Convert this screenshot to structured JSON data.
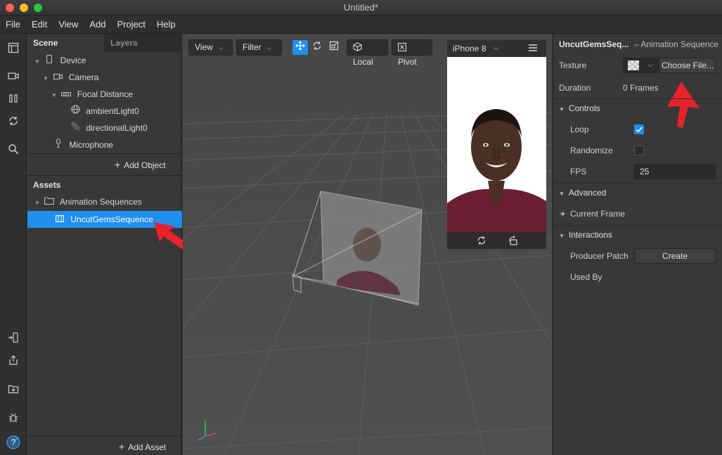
{
  "window": {
    "title": "Untitled*"
  },
  "menu": [
    "File",
    "Edit",
    "View",
    "Add",
    "Project",
    "Help"
  ],
  "scene_panel": {
    "tabs": [
      "Scene",
      "Layers"
    ],
    "items": [
      {
        "label": "Device",
        "icon": "phone-icon"
      },
      {
        "label": "Camera",
        "icon": "camera-icon"
      },
      {
        "label": "Focal Distance",
        "icon": "focal-distance-icon"
      },
      {
        "label": "ambientLight0",
        "icon": "globe-icon"
      },
      {
        "label": "directionalLight0",
        "icon": "directional-light-icon"
      },
      {
        "label": "Microphone",
        "icon": "microphone-icon"
      }
    ],
    "add_object": "Add Object"
  },
  "assets_panel": {
    "title": "Assets",
    "folder": "Animation Sequences",
    "selected_item": "UncutGemsSequence",
    "add_asset": "Add Asset"
  },
  "viewport": {
    "view_label": "View",
    "filter_label": "Filter",
    "local_label": "Local",
    "pivot_label": "Pivot",
    "device_label": "iPhone 8"
  },
  "inspector": {
    "name": "UncutGemsSeq...",
    "type": "– Animation Sequence",
    "texture_label": "Texture",
    "choose_file": "Choose File...",
    "duration_label": "Duration",
    "duration_value": "0 Frames",
    "controls_label": "Controls",
    "loop_label": "Loop",
    "randomize_label": "Randomize",
    "fps_label": "FPS",
    "fps_value": "25",
    "advanced_label": "Advanced",
    "current_frame_label": "Current Frame",
    "interactions_label": "Interactions",
    "producer_patch_label": "Producer Patch",
    "create_label": "Create",
    "used_by_label": "Used By"
  },
  "colors": {
    "accent": "#1f8ff0",
    "annotation_arrow": "#e8222a"
  }
}
